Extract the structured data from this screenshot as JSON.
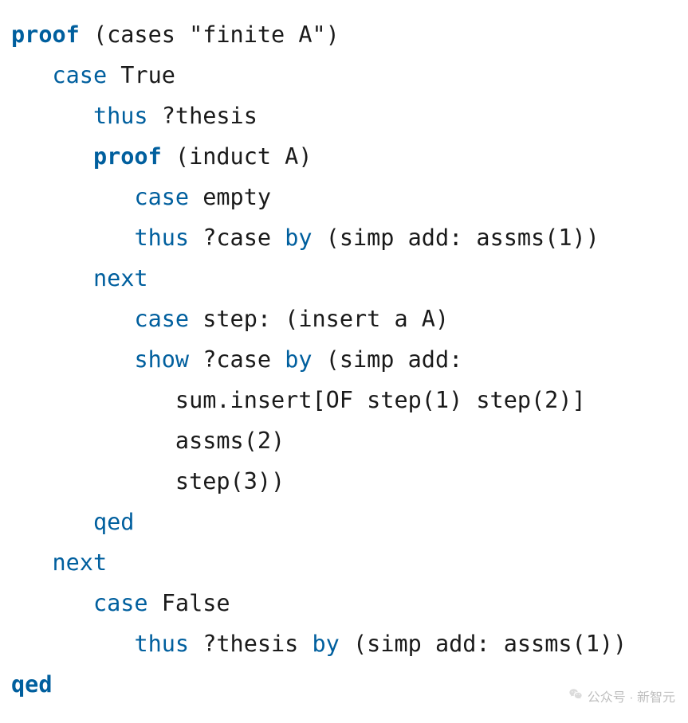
{
  "code": {
    "lines": [
      {
        "indent": 0,
        "tokens": [
          {
            "t": "proof",
            "c": "kw-bold"
          },
          {
            "t": " (cases \"finite A\")",
            "c": "txt"
          }
        ]
      },
      {
        "indent": 1,
        "tokens": [
          {
            "t": "case",
            "c": "kw"
          },
          {
            "t": " True",
            "c": "txt"
          }
        ]
      },
      {
        "indent": 2,
        "tokens": [
          {
            "t": "thus",
            "c": "kw"
          },
          {
            "t": " ?thesis",
            "c": "txt"
          }
        ]
      },
      {
        "indent": 2,
        "tokens": [
          {
            "t": "proof",
            "c": "kw-bold"
          },
          {
            "t": " (induct A)",
            "c": "txt"
          }
        ]
      },
      {
        "indent": 3,
        "tokens": [
          {
            "t": "case",
            "c": "kw"
          },
          {
            "t": " empty",
            "c": "txt"
          }
        ]
      },
      {
        "indent": 3,
        "tokens": [
          {
            "t": "thus",
            "c": "kw"
          },
          {
            "t": " ?case ",
            "c": "txt"
          },
          {
            "t": "by",
            "c": "kw"
          },
          {
            "t": " (simp add: assms(1))",
            "c": "txt"
          }
        ]
      },
      {
        "indent": 2,
        "tokens": [
          {
            "t": "next",
            "c": "kw"
          }
        ]
      },
      {
        "indent": 3,
        "tokens": [
          {
            "t": "case",
            "c": "kw"
          },
          {
            "t": " step: (insert a A)",
            "c": "txt"
          }
        ]
      },
      {
        "indent": 3,
        "tokens": [
          {
            "t": "show",
            "c": "kw"
          },
          {
            "t": " ?case ",
            "c": "txt"
          },
          {
            "t": "by",
            "c": "kw"
          },
          {
            "t": " (simp add:",
            "c": "txt"
          }
        ]
      },
      {
        "indent": 4,
        "tokens": [
          {
            "t": "sum.insert[OF step(1) step(2)]",
            "c": "txt"
          }
        ]
      },
      {
        "indent": 4,
        "tokens": [
          {
            "t": "assms(2)",
            "c": "txt"
          }
        ]
      },
      {
        "indent": 4,
        "tokens": [
          {
            "t": "step(3))",
            "c": "txt"
          }
        ]
      },
      {
        "indent": 2,
        "tokens": [
          {
            "t": "qed",
            "c": "kw"
          }
        ]
      },
      {
        "indent": 1,
        "tokens": [
          {
            "t": "next",
            "c": "kw"
          }
        ]
      },
      {
        "indent": 2,
        "tokens": [
          {
            "t": "case",
            "c": "kw"
          },
          {
            "t": " False",
            "c": "txt"
          }
        ]
      },
      {
        "indent": 3,
        "tokens": [
          {
            "t": "thus",
            "c": "kw"
          },
          {
            "t": " ?thesis ",
            "c": "txt"
          },
          {
            "t": "by",
            "c": "kw"
          },
          {
            "t": " (simp add: assms(1))",
            "c": "txt"
          }
        ]
      },
      {
        "indent": 0,
        "tokens": [
          {
            "t": "qed",
            "c": "kw-bold"
          }
        ]
      }
    ],
    "indent_unit": "   "
  },
  "watermark": {
    "text": "公众号 · 新智元"
  }
}
